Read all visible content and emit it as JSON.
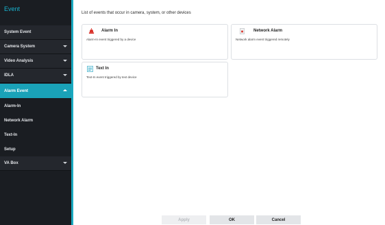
{
  "sidebar": {
    "title": "Event",
    "items": [
      {
        "label": "System Event"
      },
      {
        "label": "Camera System"
      },
      {
        "label": "Video Analysis"
      },
      {
        "label": "IDLA"
      },
      {
        "label": "Alarm Event"
      },
      {
        "label": "Alarm-In"
      },
      {
        "label": "Network Alarm"
      },
      {
        "label": "Text-In"
      },
      {
        "label": "Setup"
      },
      {
        "label": "VA Box"
      }
    ]
  },
  "main": {
    "description": "List of events that occur in camera, system, or other devices",
    "cards": [
      {
        "title": "Alarm In",
        "desc": "Alarm-In event triggered by a device",
        "icon": "alarm-icon"
      },
      {
        "title": "Network Alarm",
        "desc": "Network alarm event triggered remotely",
        "icon": "network-alarm-icon"
      },
      {
        "title": "Text In",
        "desc": "Text-In event triggered by text device",
        "icon": "text-in-icon"
      }
    ]
  },
  "buttons": {
    "apply": "Apply",
    "ok": "OK",
    "cancel": "Cancel"
  },
  "colors": {
    "sidebar_bg": "#1a1d22",
    "accent": "#1aa2b8",
    "title": "#18b3cf"
  }
}
